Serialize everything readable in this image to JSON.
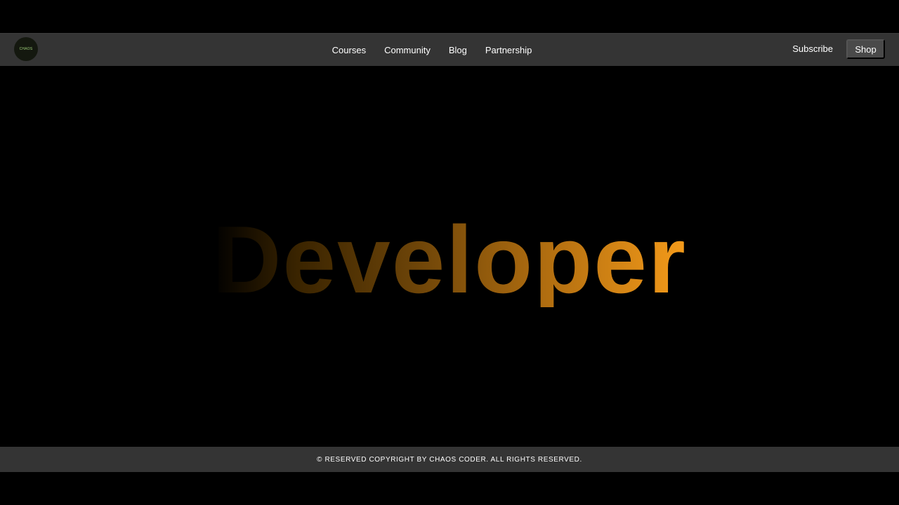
{
  "navbar": {
    "logo_text": "CHAOS",
    "links": [
      "Courses",
      "Community",
      "Blog",
      "Partnership"
    ],
    "subscribe_label": "Subscribe",
    "shop_label": "Shop"
  },
  "hero": {
    "word": "Developer"
  },
  "footer": {
    "copyright": "© RESERVED COPYRIGHT BY CHAOS CODER. ALL RIGHTS RESERVED."
  },
  "colors": {
    "background": "#000000",
    "bar": "#343434",
    "shop_button": "#4a4a4a",
    "hero_gradient_end": "#f59b1a"
  }
}
